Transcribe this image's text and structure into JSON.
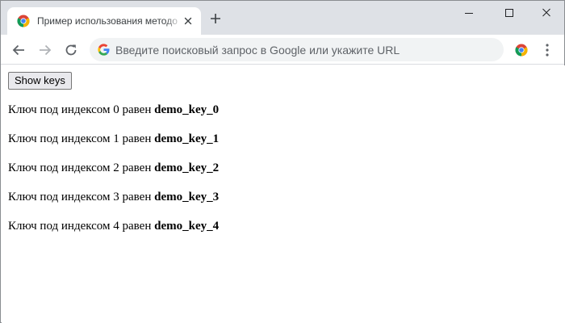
{
  "browser": {
    "tab": {
      "title": "Пример использования методо",
      "close_icon": "close-icon",
      "favicon": "chrome-favicon"
    },
    "new_tab_icon": "plus-icon",
    "window_controls": [
      "minimize-icon",
      "maximize-icon",
      "close-icon"
    ],
    "toolbar": {
      "back_icon": "arrow-left-icon",
      "forward_icon": "arrow-right-icon",
      "reload_icon": "reload-icon",
      "omnibox_placeholder": "Введите поисковый запрос в Google или укажите URL",
      "omnibox_value": "",
      "extension_icon": "chrome-extension-icon",
      "menu_icon": "kebab-menu-icon"
    },
    "colors": {
      "tabstrip_bg": "#dee1e6",
      "omnibox_bg": "#f1f3f4",
      "button_bg": "#e9e9ed"
    }
  },
  "page": {
    "button_label": "Show keys",
    "lines": [
      {
        "text": "Ключ под индексом 0 равен ",
        "key": "demo_key_0"
      },
      {
        "text": "Ключ под индексом 1 равен ",
        "key": "demo_key_1"
      },
      {
        "text": "Ключ под индексом 2 равен ",
        "key": "demo_key_2"
      },
      {
        "text": "Ключ под индексом 3 равен ",
        "key": "demo_key_3"
      },
      {
        "text": "Ключ под индексом 4 равен ",
        "key": "demo_key_4"
      }
    ]
  }
}
